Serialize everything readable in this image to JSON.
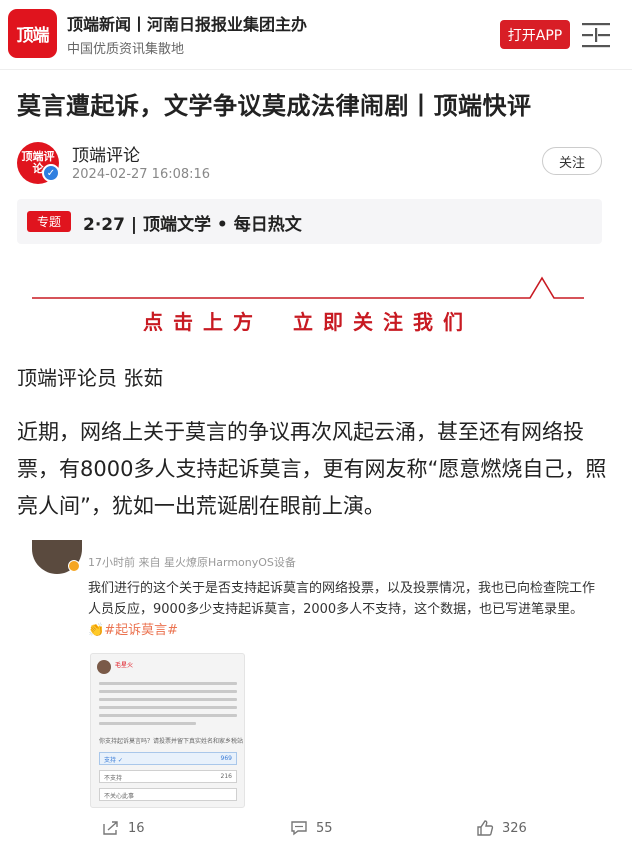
{
  "header": {
    "logo_text": "顶端",
    "title": "顶端新闻丨河南日报报业集团主办",
    "subtitle": "中国优质资讯集散地",
    "open_app": "打开APP",
    "brand_color": "#d81e26"
  },
  "article": {
    "title": "莫言遭起诉，文学争议莫成法律闹剧丨顶端快评",
    "author": {
      "avatar_text": "顶端评论",
      "name": "顶端评论",
      "time": "2024-02-27 16:08:16",
      "follow_label": "关注"
    },
    "topic": {
      "tag": "专题",
      "title": "2·27 | 顶端文学 • 每日热文"
    },
    "banner_text": "点击上方　立即关注我们",
    "byline": "顶端评论员 张茹",
    "paragraph": "近期，网络上关于莫言的争议再次风起云涌，甚至还有网络投票，有8000多人支持起诉莫言，更有网友称“愿意燃烧自己，照亮人间”，犹如一出荒诞剧在眼前上演。"
  },
  "embed": {
    "meta": "17小时前 来自 星火燎原HarmonyOS设备",
    "text": "我们进行的这个关于是否支持起诉莫言的网络投票，以及投票情况，我也已向检查院工作人员反应，9000多少支持起诉莫言，2000多人不支持，这个数据，也已写进笔录里。",
    "hashtag": "#起诉莫言#",
    "thumb": {
      "name": "毛星火",
      "question": "你支持起诉莫言吗？请投票并留下真实姓名和家乡税站",
      "options": [
        {
          "label": "支持 ✓",
          "count": "969"
        },
        {
          "label": "不支持",
          "count": "216"
        },
        {
          "label": "不关心此事",
          "count": ""
        }
      ]
    },
    "actions": {
      "share": "16",
      "comment": "55",
      "like": "326"
    },
    "hashtag_color": "#eb7350"
  }
}
